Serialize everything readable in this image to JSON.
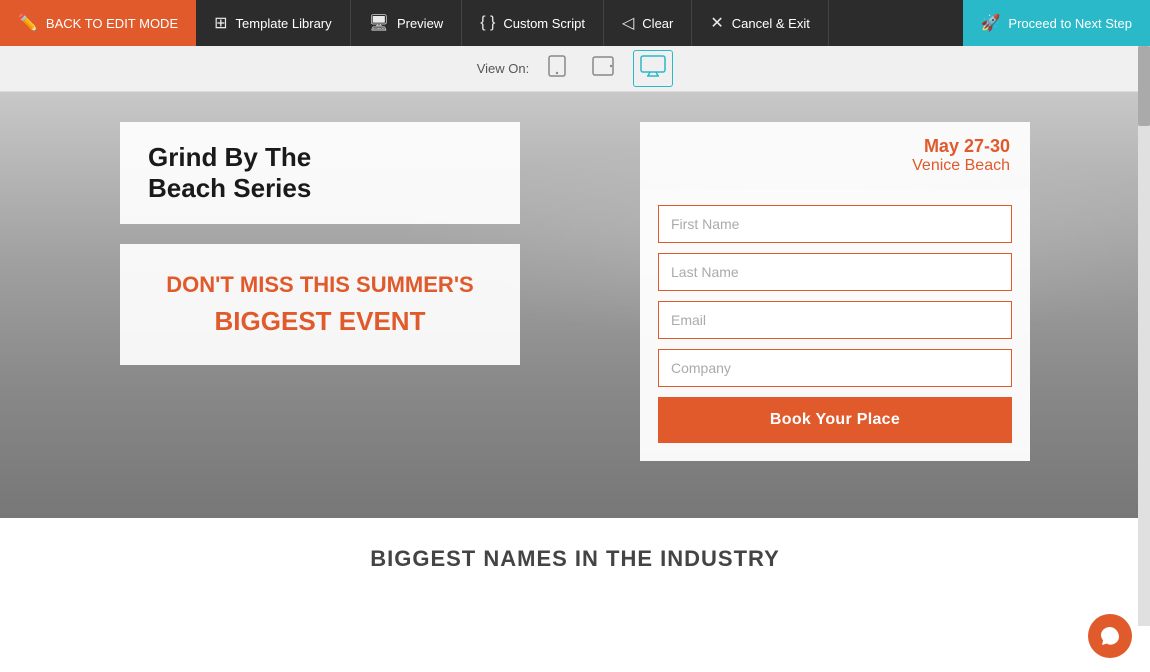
{
  "nav": {
    "back_label": "BACK TO EDIT MODE",
    "template_label": "Template Library",
    "preview_label": "Preview",
    "custom_script_label": "Custom Script",
    "clear_label": "Clear",
    "cancel_label": "Cancel & Exit",
    "proceed_label": "Proceed to Next Step"
  },
  "view_on": {
    "label": "View On:",
    "icons": [
      "mobile",
      "tablet",
      "desktop"
    ]
  },
  "hero": {
    "title_line1": "Grind By The",
    "title_line2": "Beach Series",
    "event_line1": "DON'T MISS THIS SUMMER'S",
    "event_line2": "BIGGEST EVENT",
    "date": "May 27-30",
    "location": "Venice Beach",
    "form": {
      "first_name_placeholder": "First Name",
      "last_name_placeholder": "Last Name",
      "email_placeholder": "Email",
      "company_placeholder": "Company",
      "button_label": "Book Your Place"
    }
  },
  "bottom": {
    "heading": "BIGGEST NAMES IN THE INDUSTRY"
  },
  "colors": {
    "orange": "#e05a2b",
    "teal": "#2ab9c8",
    "dark": "#2c2c2c"
  }
}
